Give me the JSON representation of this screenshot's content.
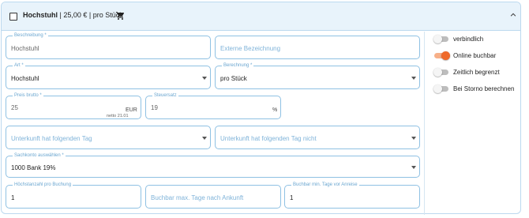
{
  "header": {
    "title": "Hochstuhl",
    "price_info": " | 25,00 € | pro Stück",
    "checked": false
  },
  "form": {
    "beschreibung": {
      "label": "Beschreibung *",
      "value": "Hochstuhl"
    },
    "externe_bezeichnung": {
      "placeholder": "Externe Bezeichnung"
    },
    "art": {
      "label": "Art *",
      "value": "Hochstuhl"
    },
    "berechnung": {
      "label": "Berechnung *",
      "value": "pro Stück"
    },
    "preis_brutto": {
      "label": "Preis brutto *",
      "value": "25",
      "currency": "EUR",
      "netto": "netto 21.01"
    },
    "steuersatz": {
      "label": "Steuersatz",
      "value": "19",
      "unit": "%"
    },
    "unterkunft_tag": {
      "placeholder": "Unterkunft hat folgenden Tag"
    },
    "unterkunft_tag_nicht": {
      "placeholder": "Unterkunft hat folgenden Tag nicht"
    },
    "sachkonto": {
      "label": "Sachkonto auswählen *",
      "value": "1000 Bank 19%"
    },
    "hoechstanzahl": {
      "label": "Höchstanzahl pro Buchung",
      "value": "1"
    },
    "buchbar_max": {
      "placeholder": "Buchbar max. Tage nach Ankunft"
    },
    "buchbar_min": {
      "label": "Buchbar min. Tage vor Anreise",
      "value": "1"
    }
  },
  "toggles": [
    {
      "label": "verbindlich",
      "on": false
    },
    {
      "label": "Online buchbar",
      "on": true
    },
    {
      "label": "Zeitlich begrenzt",
      "on": false
    },
    {
      "label": "Bei Storno berechnen",
      "on": false
    }
  ],
  "colors": {
    "header_bg": "#e8f3fb",
    "border": "#8fc1e3",
    "accent_toggle": "#ef6a2a",
    "label": "#6aa6d0"
  },
  "icons": {
    "cart": "cart-icon",
    "collapse": "chevron-up-icon",
    "caret": "caret-down-icon"
  }
}
